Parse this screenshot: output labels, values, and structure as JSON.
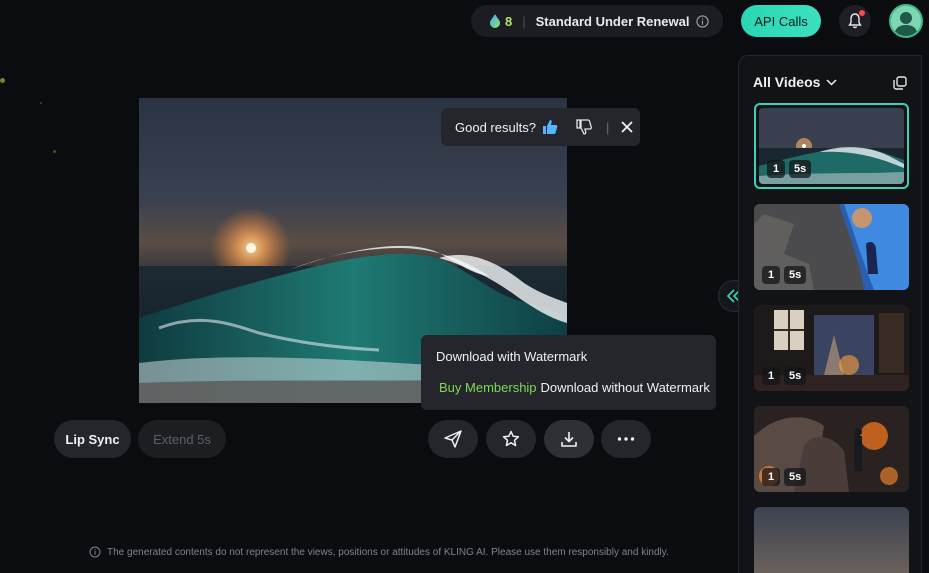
{
  "header": {
    "credits": "8",
    "plan_label": "Standard Under Renewal",
    "api_button": "API Calls"
  },
  "feedback": {
    "prompt": "Good results?"
  },
  "download_menu": {
    "with_watermark": "Download with Watermark",
    "buy_membership": "Buy Membership",
    "without_watermark": "Download without Watermark"
  },
  "actions": {
    "lip_sync": "Lip Sync",
    "extend": "Extend 5s"
  },
  "disclaimer": "The generated contents do not represent the views, positions or attitudes of KLING AI. Please use them responsibly and kindly.",
  "sidebar": {
    "title": "All Videos",
    "items": [
      {
        "count": "1",
        "duration": "5s"
      },
      {
        "count": "1",
        "duration": "5s"
      },
      {
        "count": "1",
        "duration": "5s"
      },
      {
        "count": "1",
        "duration": "5s"
      }
    ]
  },
  "colors": {
    "accent": "#3ed1b6",
    "credits": "#b9e26b",
    "buy_membership": "#7ed957"
  }
}
